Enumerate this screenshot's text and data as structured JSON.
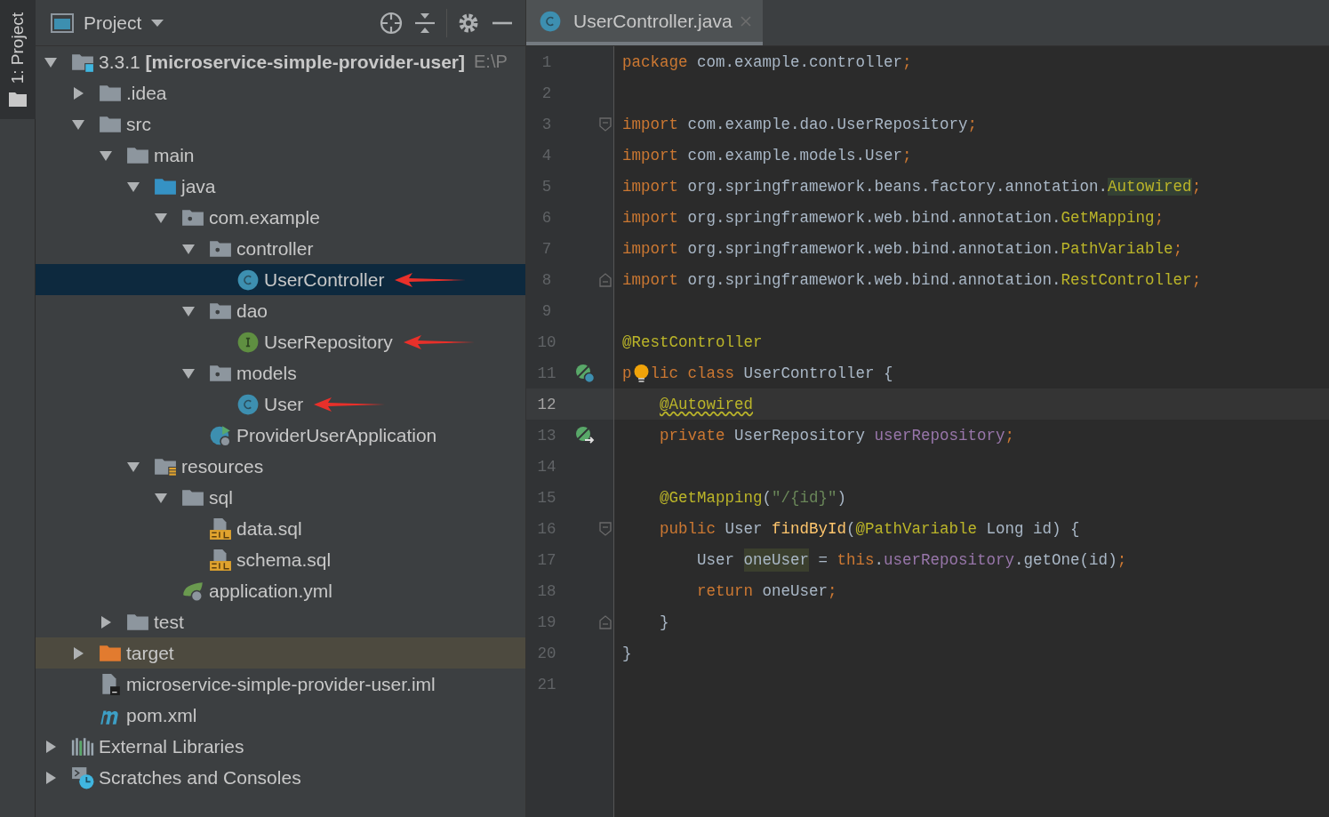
{
  "tool_stripe": {
    "label": "1: Project"
  },
  "project_panel": {
    "title": "Project",
    "tree": [
      {
        "label": "3.3.1 **[microservice-simple-provider-user]**",
        "suffix": "E:\\P",
        "kind": "module",
        "expanded": true,
        "selected": false,
        "hovered": false,
        "annotated": false,
        "children": [
          {
            "label": ".idea",
            "kind": "folder",
            "expanded": false,
            "selected": false,
            "hovered": false,
            "annotated": false
          },
          {
            "label": "src",
            "kind": "folder",
            "expanded": true,
            "selected": false,
            "hovered": false,
            "annotated": false,
            "children": [
              {
                "label": "main",
                "kind": "folder",
                "expanded": true,
                "selected": false,
                "hovered": false,
                "annotated": false,
                "children": [
                  {
                    "label": "java",
                    "kind": "source-folder",
                    "expanded": true,
                    "selected": false,
                    "hovered": false,
                    "annotated": false,
                    "children": [
                      {
                        "label": "com.example",
                        "kind": "package",
                        "expanded": true,
                        "selected": false,
                        "hovered": false,
                        "annotated": false,
                        "children": [
                          {
                            "label": "controller",
                            "kind": "package",
                            "expanded": true,
                            "selected": false,
                            "hovered": false,
                            "annotated": false,
                            "children": [
                              {
                                "label": "UserController",
                                "kind": "class",
                                "selected": true,
                                "hovered": false,
                                "annotated": true
                              }
                            ]
                          },
                          {
                            "label": "dao",
                            "kind": "package",
                            "expanded": true,
                            "selected": false,
                            "hovered": false,
                            "annotated": false,
                            "children": [
                              {
                                "label": "UserRepository",
                                "kind": "interface",
                                "selected": false,
                                "hovered": false,
                                "annotated": true
                              }
                            ]
                          },
                          {
                            "label": "models",
                            "kind": "package",
                            "expanded": true,
                            "selected": false,
                            "hovered": false,
                            "annotated": false,
                            "children": [
                              {
                                "label": "User",
                                "kind": "class",
                                "selected": false,
                                "hovered": false,
                                "annotated": true
                              }
                            ]
                          },
                          {
                            "label": "ProviderUserApplication",
                            "kind": "app",
                            "selected": false,
                            "hovered": false,
                            "annotated": false
                          }
                        ]
                      }
                    ]
                  },
                  {
                    "label": "resources",
                    "kind": "resource-folder",
                    "expanded": true,
                    "selected": false,
                    "hovered": false,
                    "annotated": false,
                    "children": [
                      {
                        "label": "sql",
                        "kind": "folder",
                        "expanded": true,
                        "selected": false,
                        "hovered": false,
                        "annotated": false,
                        "children": [
                          {
                            "label": "data.sql",
                            "kind": "sql",
                            "selected": false,
                            "hovered": false,
                            "annotated": false
                          },
                          {
                            "label": "schema.sql",
                            "kind": "sql",
                            "selected": false,
                            "hovered": false,
                            "annotated": false
                          }
                        ]
                      },
                      {
                        "label": "application.yml",
                        "kind": "yml",
                        "selected": false,
                        "hovered": false,
                        "annotated": false
                      }
                    ]
                  }
                ]
              },
              {
                "label": "test",
                "kind": "folder",
                "expanded": false,
                "selected": false,
                "hovered": false,
                "annotated": false
              }
            ]
          },
          {
            "label": "target",
            "kind": "excluded-folder",
            "expanded": false,
            "selected": false,
            "hovered": true,
            "annotated": false
          },
          {
            "label": "microservice-simple-provider-user.iml",
            "kind": "iml",
            "selected": false,
            "hovered": false,
            "annotated": false
          },
          {
            "label": "pom.xml",
            "kind": "maven",
            "selected": false,
            "hovered": false,
            "annotated": false
          }
        ]
      },
      {
        "label": "External Libraries",
        "kind": "libraries",
        "expanded": false,
        "selected": false,
        "hovered": false,
        "annotated": false
      },
      {
        "label": "Scratches and Consoles",
        "kind": "scratches",
        "expanded": false,
        "selected": false,
        "hovered": false,
        "annotated": false
      }
    ]
  },
  "editor": {
    "tabs": [
      {
        "label": "UserController.java",
        "selected": true
      }
    ],
    "lines": [
      {
        "number": "1",
        "current": false,
        "tokens": [
          {
            "kind": "kw",
            "text": "package"
          },
          {
            "kind": "plain",
            "text": " com.example.controller"
          },
          {
            "kind": "kw",
            "text": ";"
          }
        ]
      },
      {
        "number": "2",
        "current": false
      },
      {
        "number": "3",
        "current": false,
        "kind": "fold-start",
        "tokens": [
          {
            "kind": "kw",
            "text": "import"
          },
          {
            "kind": "plain",
            "text": " com.example.dao.UserRepository"
          },
          {
            "kind": "kw",
            "text": ";"
          }
        ]
      },
      {
        "number": "4",
        "current": false,
        "tokens": [
          {
            "kind": "kw",
            "text": "import"
          },
          {
            "kind": "plain",
            "text": " com.example.models.User"
          },
          {
            "kind": "kw",
            "text": ";"
          }
        ]
      },
      {
        "number": "5",
        "current": false,
        "tokens": [
          {
            "kind": "kw",
            "text": "import"
          },
          {
            "kind": "plain",
            "text": " org.springframework.beans.factory.annotation."
          },
          {
            "kind": "ann-marked",
            "text": "Autowired"
          },
          {
            "kind": "kw",
            "text": ";"
          }
        ]
      },
      {
        "number": "6",
        "current": false,
        "tokens": [
          {
            "kind": "kw",
            "text": "import"
          },
          {
            "kind": "plain",
            "text": " org.springframework.web.bind.annotation."
          },
          {
            "kind": "ann",
            "text": "GetMapping"
          },
          {
            "kind": "kw",
            "text": ";"
          }
        ]
      },
      {
        "number": "7",
        "current": false,
        "tokens": [
          {
            "kind": "kw",
            "text": "import"
          },
          {
            "kind": "plain",
            "text": " org.springframework.web.bind.annotation."
          },
          {
            "kind": "ann",
            "text": "PathVariable"
          },
          {
            "kind": "kw",
            "text": ";"
          }
        ]
      },
      {
        "number": "8",
        "current": false,
        "kind": "fold-end",
        "tokens": [
          {
            "kind": "kw",
            "text": "import"
          },
          {
            "kind": "plain",
            "text": " org.springframework.web.bind.annotation."
          },
          {
            "kind": "ann",
            "text": "RestController"
          },
          {
            "kind": "kw",
            "text": ";"
          }
        ]
      },
      {
        "number": "9",
        "current": false
      },
      {
        "number": "10",
        "current": false,
        "tokens": [
          {
            "kind": "ann",
            "text": "@RestController"
          }
        ]
      },
      {
        "number": "11",
        "current": false,
        "kind": "bean",
        "tokens": [
          {
            "kind": "kw",
            "text": "p"
          },
          {
            "kind": "bulb"
          },
          {
            "kind": "kw",
            "text": "lic class"
          },
          {
            "kind": "plain",
            "text": " UserController {"
          }
        ],
        "children": [
          {
            "number": "12",
            "current": true,
            "tokens": [
              {
                "kind": "ann-wavy",
                "text": "@Autowired"
              }
            ]
          },
          {
            "number": "13",
            "current": false,
            "kind": "bean-link",
            "tokens": [
              {
                "kind": "kw",
                "text": "private"
              },
              {
                "kind": "plain",
                "text": " UserRepository "
              },
              {
                "kind": "field",
                "text": "userRepository"
              },
              {
                "kind": "kw",
                "text": ";"
              }
            ]
          },
          {
            "number": "14",
            "current": false
          },
          {
            "number": "15",
            "current": false,
            "tokens": [
              {
                "kind": "ann",
                "text": "@GetMapping"
              },
              {
                "kind": "plain",
                "text": "("
              },
              {
                "kind": "str",
                "text": "\"/{id}\""
              },
              {
                "kind": "plain",
                "text": ")"
              }
            ]
          },
          {
            "number": "16",
            "current": false,
            "kind": "fold-start",
            "tokens": [
              {
                "kind": "kw",
                "text": "public"
              },
              {
                "kind": "plain",
                "text": " User "
              },
              {
                "kind": "method",
                "text": "findById"
              },
              {
                "kind": "plain",
                "text": "("
              },
              {
                "kind": "ann",
                "text": "@PathVariable"
              },
              {
                "kind": "plain",
                "text": " Long id) {"
              }
            ],
            "children": [
              {
                "number": "17",
                "current": false,
                "tokens": [
                  {
                    "kind": "plain",
                    "text": "User "
                  },
                  {
                    "kind": "usage",
                    "text": "oneUser"
                  },
                  {
                    "kind": "plain",
                    "text": " = "
                  },
                  {
                    "kind": "kw",
                    "text": "this"
                  },
                  {
                    "kind": "plain",
                    "text": "."
                  },
                  {
                    "kind": "field",
                    "text": "userRepository"
                  },
                  {
                    "kind": "plain",
                    "text": ".getOne(id)"
                  },
                  {
                    "kind": "kw",
                    "text": ";"
                  }
                ]
              },
              {
                "number": "18",
                "current": false,
                "tokens": [
                  {
                    "kind": "kw",
                    "text": "return"
                  },
                  {
                    "kind": "plain",
                    "text": " oneUser"
                  },
                  {
                    "kind": "kw",
                    "text": ";"
                  }
                ]
              }
            ]
          },
          {
            "number": "19",
            "current": false,
            "kind": "fold-end",
            "tokens": [
              {
                "kind": "plain",
                "text": "}"
              }
            ]
          }
        ]
      },
      {
        "number": "20",
        "current": false,
        "tokens": [
          {
            "kind": "plain",
            "text": "}"
          }
        ]
      },
      {
        "number": "21",
        "current": false
      }
    ]
  }
}
